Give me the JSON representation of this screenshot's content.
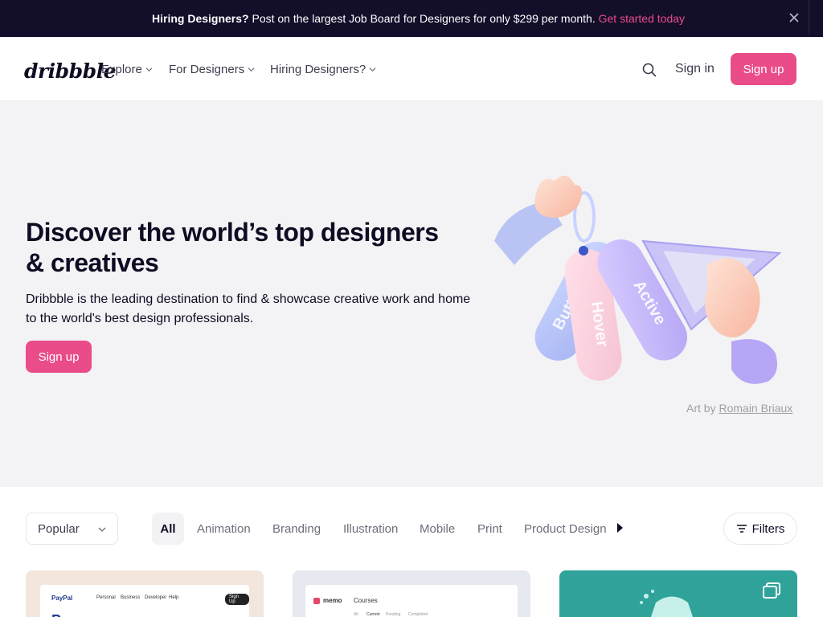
{
  "banner": {
    "lead": "Hiring Designers?",
    "text": " Post on the largest Job Board for Designers for only $299 per month. ",
    "cta": "Get started today"
  },
  "header": {
    "logo": "dribbble",
    "nav": [
      {
        "label": "Explore"
      },
      {
        "label": "For Designers"
      },
      {
        "label": "Hiring Designers?"
      }
    ],
    "sign_in": "Sign in",
    "sign_up": "Sign up"
  },
  "hero": {
    "title_line1": "Discover the world’s top designers",
    "title_line2": "& creatives",
    "subtitle": "Dribbble is the leading destination to find & showcase creative work and home to the world's best design professionals.",
    "cta": "Sign up",
    "art_tags": [
      "Button",
      "Hover",
      "Active"
    ],
    "art_credit_prefix": "Art by ",
    "art_credit_name": "Romain Briaux"
  },
  "filters": {
    "sort": "Popular",
    "categories": [
      {
        "label": "All",
        "active": true
      },
      {
        "label": "Animation"
      },
      {
        "label": "Branding"
      },
      {
        "label": "Illustration"
      },
      {
        "label": "Mobile"
      },
      {
        "label": "Print"
      },
      {
        "label": "Product Design"
      }
    ],
    "filters_label": "Filters"
  },
  "shots": [
    {
      "brand": "PayPal",
      "nav": [
        "Personal",
        "Business",
        "Developer",
        "Help"
      ],
      "button": "Sign Up",
      "headline": "P"
    },
    {
      "brand": "memo",
      "title": "Courses",
      "tabs": [
        "All",
        "Current",
        "Pending",
        "Completed"
      ]
    },
    {
      "brand": ""
    }
  ],
  "colors": {
    "accent": "#ea4c89",
    "banner_bg": "#130e2a",
    "hero_bg": "#f3f3f5"
  }
}
